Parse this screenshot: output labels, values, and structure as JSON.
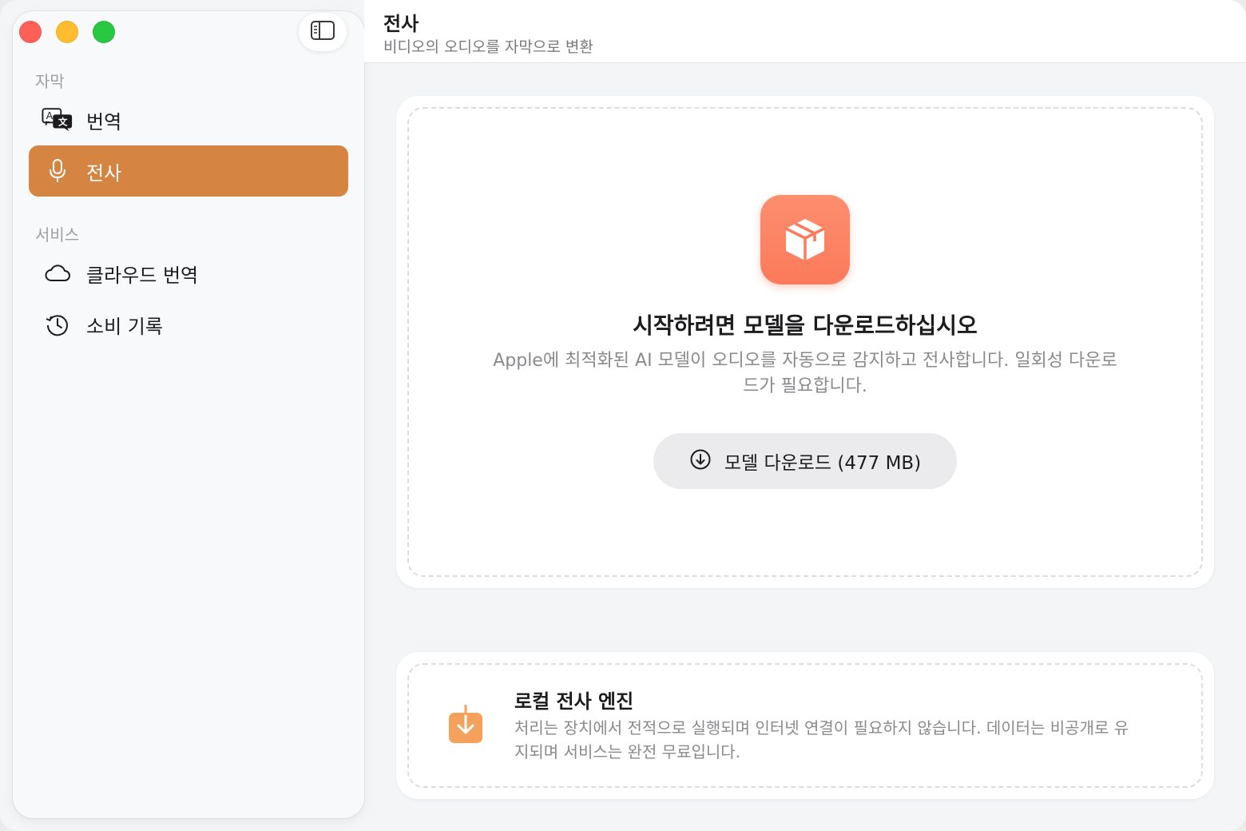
{
  "window": {
    "traffic_lights": [
      "close",
      "minimize",
      "zoom"
    ]
  },
  "sidebar": {
    "toggle_icon": "sidebar-toggle-icon",
    "sections": [
      {
        "label": "자막",
        "items": [
          {
            "label": "번역",
            "icon": "translate-icon",
            "active": false
          },
          {
            "label": "전사",
            "icon": "microphone-icon",
            "active": true
          }
        ]
      },
      {
        "label": "서비스",
        "items": [
          {
            "label": "클라우드 번역",
            "icon": "cloud-icon",
            "active": false
          },
          {
            "label": "소비 기록",
            "icon": "history-icon",
            "active": false
          }
        ]
      }
    ]
  },
  "header": {
    "title": "전사",
    "subtitle": "비디오의 오디오를 자막으로 변환"
  },
  "download_card": {
    "icon": "package-icon",
    "headline": "시작하려면 모델을 다운로드하십시오",
    "description": "Apple에 최적화된 AI 모델이 오디오를 자동으로 감지하고 전사합니다. 일회성 다운로드가 필요합니다.",
    "button_label": "모델 다운로드 (477 MB)",
    "button_icon": "download-circle-icon"
  },
  "engine_card": {
    "icon": "download-box-icon",
    "title": "로컬 전사 엔진",
    "description": "처리는 장치에서 전적으로 실행되며 인터넷 연결이 필요하지 않습니다. 데이터는 비공개로 유지되며 서비스는 완전 무료입니다."
  },
  "colors": {
    "accent": "#d58441",
    "app_icon": "#fb7a5b",
    "engine_icon": "#f4a15c"
  }
}
